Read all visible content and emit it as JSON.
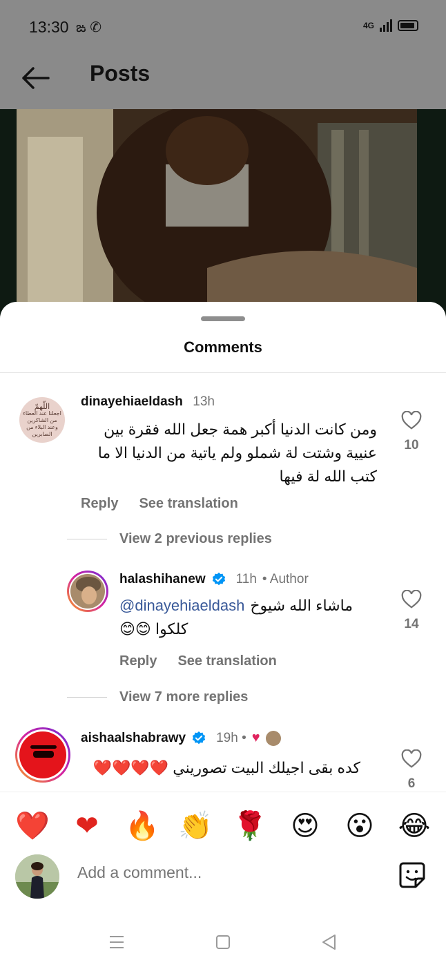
{
  "status_bar": {
    "time": "13:30",
    "network": "4G"
  },
  "header": {
    "title": "Posts"
  },
  "sheet": {
    "title": "Comments"
  },
  "comments": [
    {
      "username": "dinayehiaeldash",
      "time": "13h",
      "text_lines": [
        "ومن كانت الدنيا أكبر همة جعل الله فقرة بين",
        "عنيية وشتت لة شملو ولم ياتية من الدنيا الا ما",
        "كتب الله لة فيها"
      ],
      "likes": "10",
      "reply_label": "Reply",
      "translate_label": "See translation",
      "avatar_text_lines": [
        "اللّهمّ",
        "اجعلنا عند العطاء من الشاكرين",
        "وعند البلاء من الصابرين"
      ]
    },
    {
      "username": "halashihanew",
      "time": "11h",
      "author_label": "• Author",
      "mention": "@dinayehiaeldash",
      "text_line1": "ماشاء الله شيوخ",
      "text_line2": "كلكوا 😊😊",
      "likes": "14",
      "reply_label": "Reply",
      "translate_label": "See translation"
    },
    {
      "username": "aishaalshabrawy",
      "time": "19h •",
      "text": "كده بقى اجيلك البيت تصوريني ❤️❤️❤️❤️",
      "likes": "6"
    }
  ],
  "view_previous": "View 2 previous replies",
  "view_more": "View 7 more replies",
  "reactions": [
    "❤️",
    "🙌",
    "🔥",
    "👏",
    "🌹",
    "😍",
    "😮",
    "😂"
  ],
  "composer": {
    "placeholder": "Add a comment..."
  },
  "colors": {
    "link": "#385898",
    "muted": "#737373",
    "verified": "#0095f6",
    "heart": "#e0245e"
  }
}
